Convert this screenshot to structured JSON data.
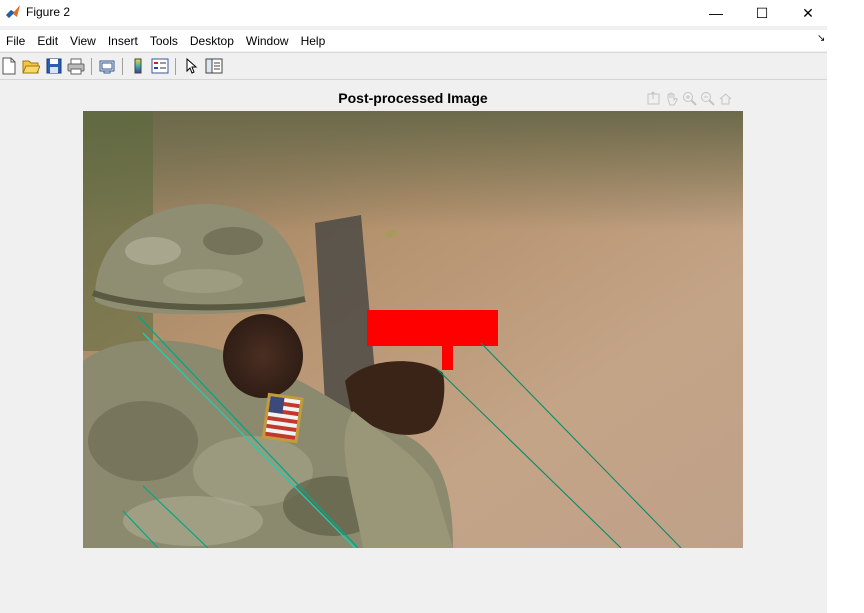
{
  "window": {
    "title": "Figure 2",
    "minimize_glyph": "—",
    "maximize_glyph": "☐",
    "close_glyph": "✕"
  },
  "menu": {
    "items": [
      "File",
      "Edit",
      "View",
      "Insert",
      "Tools",
      "Desktop",
      "Window",
      "Help"
    ],
    "dock_glyph": "↘"
  },
  "toolbar": {
    "buttons": [
      "new-figure-icon",
      "open-file-icon",
      "save-icon",
      "print-icon",
      "link-plot-icon",
      "colorbar-icon",
      "legend-icon",
      "pointer-icon",
      "property-inspector-icon"
    ]
  },
  "axes": {
    "title": "Post-processed Image",
    "toolbar_icons": [
      "export-icon",
      "pan-icon",
      "zoom-in-icon",
      "zoom-out-icon",
      "home-icon"
    ]
  },
  "colors": {
    "overlay_box": "#ff0000",
    "detection_lines": "#00a884",
    "flag_red": "#c0392b"
  }
}
